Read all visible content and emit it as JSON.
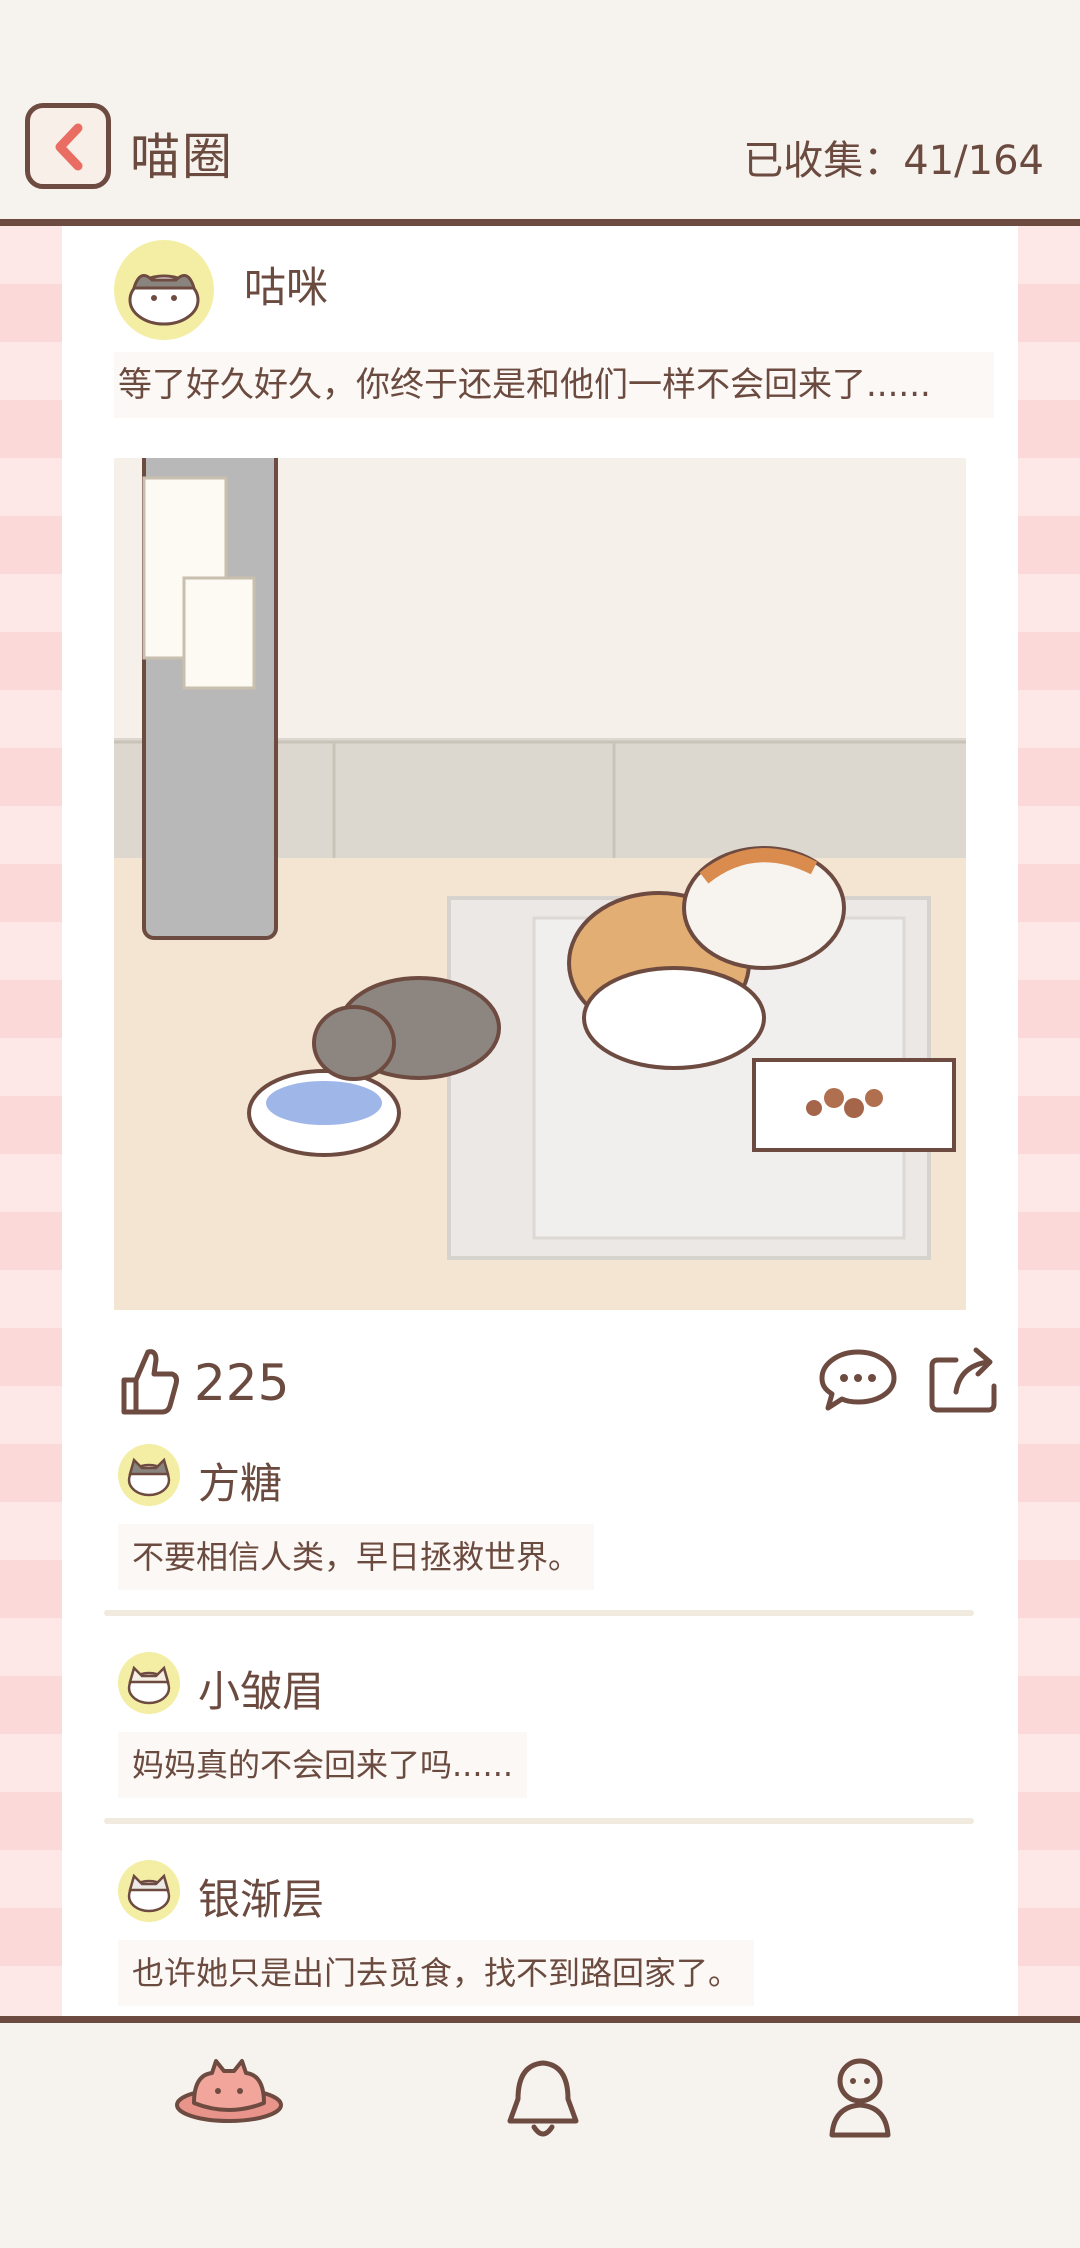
{
  "header": {
    "title": "喵圈",
    "collected_label": "已收集：41/164"
  },
  "post": {
    "author": "咕咪",
    "text": "等了好久好久，你终于还是和他们一样不会回来了......",
    "likes": "225"
  },
  "comments": [
    {
      "name": "方糖",
      "text": "不要相信人类，早日拯救世界。"
    },
    {
      "name": "小皱眉",
      "text": "妈妈真的不会回来了吗......"
    },
    {
      "name": "银渐层",
      "text": "也许她只是出门去觅食，找不到路回家了。"
    }
  ],
  "colors": {
    "outline": "#6e4b41",
    "accent": "#e96d63",
    "stripe": "#fcd9d9"
  },
  "icons": [
    "back-arrow-icon",
    "like-icon",
    "comment-icon",
    "share-icon",
    "planet-cat-icon",
    "bell-icon",
    "profile-icon"
  ]
}
